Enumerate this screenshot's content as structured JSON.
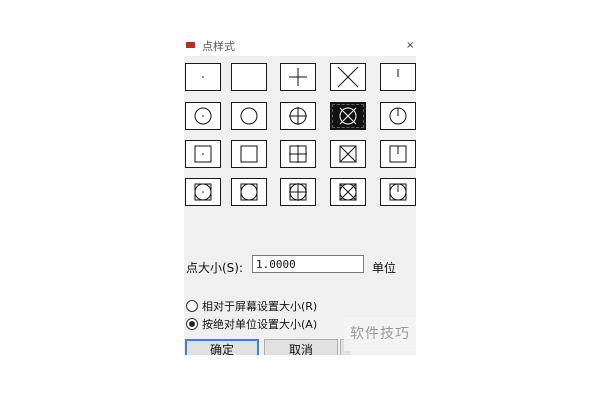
{
  "dialog": {
    "title": "点样式",
    "close_glyph": "×"
  },
  "styles": [
    {
      "name": "point-style-dot"
    },
    {
      "name": "point-style-none"
    },
    {
      "name": "point-style-plus"
    },
    {
      "name": "point-style-x"
    },
    {
      "name": "point-style-tick"
    },
    {
      "name": "point-style-circle-dot"
    },
    {
      "name": "point-style-circle"
    },
    {
      "name": "point-style-circle-plus"
    },
    {
      "name": "point-style-circle-x",
      "selected": true
    },
    {
      "name": "point-style-circle-tick"
    },
    {
      "name": "point-style-square-dot"
    },
    {
      "name": "point-style-square"
    },
    {
      "name": "point-style-square-plus"
    },
    {
      "name": "point-style-square-x"
    },
    {
      "name": "point-style-square-tick"
    },
    {
      "name": "point-style-square-circle-dot"
    },
    {
      "name": "point-style-square-circle"
    },
    {
      "name": "point-style-square-circle-plus"
    },
    {
      "name": "point-style-square-circle-x"
    },
    {
      "name": "point-style-square-circle-tick"
    }
  ],
  "size": {
    "label": "点大小(S):",
    "value": "1.0000",
    "unit": "单位"
  },
  "mode": {
    "relative_label": "相对于屏幕设置大小(R)",
    "absolute_label": "按绝对单位设置大小(A)",
    "selected": "absolute"
  },
  "buttons": {
    "ok": "确定",
    "cancel": "取消"
  },
  "watermark": "软件技巧"
}
